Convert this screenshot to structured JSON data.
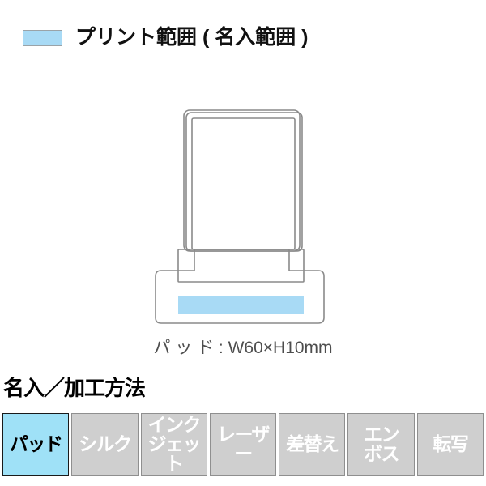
{
  "legend": {
    "swatch_name": "print-area-swatch",
    "swatch_color": "#a8daf5",
    "label": "プリント範囲 ( 名入範囲 )"
  },
  "product": {
    "alt_name": "acrylic-stand-frame-illustration",
    "outline_color": "#8a8a8a",
    "print_area_color": "#a8daf5",
    "caption": "パ ッ ド : W60×H10mm"
  },
  "section": {
    "heading": "名入／加工方法"
  },
  "methods": {
    "active_index": 0,
    "active_bg": "#9fe1f7",
    "inactive_bg": "#cfcfcf",
    "items": [
      {
        "label": "パッド",
        "lines": "パッド",
        "active": true
      },
      {
        "label": "シルク",
        "lines": "シルク",
        "active": false
      },
      {
        "label": "インクジェット",
        "lines": "インク\nジェット",
        "active": false
      },
      {
        "label": "レーザー",
        "lines": "レーザー",
        "active": false
      },
      {
        "label": "差替え",
        "lines": "差替え",
        "active": false
      },
      {
        "label": "エンボス",
        "lines": "エン\nボス",
        "active": false
      },
      {
        "label": "転写",
        "lines": "転写",
        "active": false
      }
    ]
  }
}
